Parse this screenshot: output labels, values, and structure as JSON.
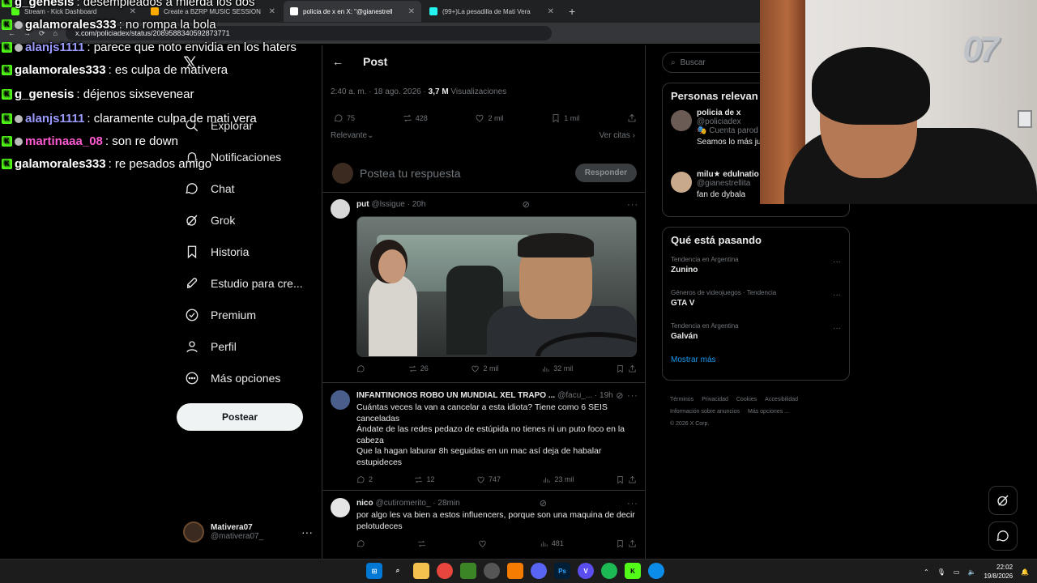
{
  "browser": {
    "tabs": [
      {
        "label": "Stream - Kick Dashboard",
        "fav": "#53fc18",
        "active": false
      },
      {
        "label": "Create a BZRP MUSIC SESSION",
        "fav": "#f9ab00",
        "active": false
      },
      {
        "label": "policia de x en X: \"@gianestrell",
        "fav": "#ffffff",
        "active": true
      },
      {
        "label": "(99+)La pesadilla de Mati Vera",
        "fav": "#25f4ee",
        "active": false
      }
    ],
    "url": "x.com/policiadex/status/2089588340592873771"
  },
  "chat": [
    {
      "user": "g_genesis",
      "color": "#ffffff",
      "msg": ": desempleados a mierda los dos"
    },
    {
      "user": "galamorales333",
      "color": "#ffffff",
      "msg": ": no rompa la bola"
    },
    {
      "user": "alanjs1111",
      "color": "#9b9bff",
      "msg": ": parece que noto envidia en los haters"
    },
    {
      "user": "galamorales333",
      "color": "#ffffff",
      "msg": ": es culpa de matívera"
    },
    {
      "user": "g_genesis",
      "color": "#ffffff",
      "msg": ": déjenos sixsevenear"
    },
    {
      "user": "alanjs1111",
      "color": "#9b9bff",
      "msg": ": claramente culpa de mati vera"
    },
    {
      "user": "martinaaa_08",
      "color": "#ff5ad1",
      "msg": ": son re down"
    },
    {
      "user": "galamorales333",
      "color": "#ffffff",
      "msg": ": re pesados amigo"
    }
  ],
  "nav": {
    "logo": "𝕏",
    "items": [
      {
        "label": "Explorar",
        "icon": "search-icon"
      },
      {
        "label": "Notificaciones",
        "icon": "bell-icon"
      },
      {
        "label": "Chat",
        "icon": "chat-icon"
      },
      {
        "label": "Grok",
        "icon": "grok-icon"
      },
      {
        "label": "Historia",
        "icon": "bookmark-icon"
      },
      {
        "label": "Estudio para cre...",
        "icon": "rocket-icon"
      },
      {
        "label": "Premium",
        "icon": "verified-icon"
      },
      {
        "label": "Perfil",
        "icon": "person-icon"
      },
      {
        "label": "Más opciones",
        "icon": "more-circle-icon"
      }
    ],
    "post_label": "Postear",
    "me": {
      "name": "Mativera07",
      "handle": "@mativera07_"
    }
  },
  "post": {
    "header": "Post",
    "time": "2:40 a. m. · 18 ago. 2026 · ",
    "views_count": "3,7 M",
    "views_label": " Visualizaciones",
    "stats": {
      "replies": "75",
      "reposts": "428",
      "likes": "2 mil",
      "bookmarks": "1 mil"
    },
    "sort": "Relevante",
    "quotes": "Ver citas",
    "reply_placeholder": "Postea tu respuesta",
    "reply_button": "Responder"
  },
  "replies": [
    {
      "name": "put",
      "handle": "@lssigue · 20h",
      "text": "",
      "replies": "",
      "reposts": "26",
      "likes": "2 mil",
      "views": "32 mil"
    },
    {
      "name": "INFANTINONOS ROBO UN MUNDIAL XEL TRAPO ...",
      "handle": "@facu_... · 19h",
      "lines": [
        "Cuántas veces la van a cancelar a esta idiota? Tiene como 6 SEIS canceladas",
        "Ándate de las redes pedazo de estúpida no tienes ni un puto foco en la cabeza",
        "Que la hagan laburar 8h seguidas en un mac así deja de habalar estupideces"
      ],
      "replies": "2",
      "reposts": "12",
      "likes": "747",
      "views": "23 mil"
    },
    {
      "name": "nico",
      "handle": "@cutiromerito_ · 28min",
      "lines": [
        "por algo les va bien a estos influencers, porque son una maquina de decir pelotudeces"
      ],
      "replies": "",
      "reposts": "",
      "likes": "",
      "views": "481"
    }
  ],
  "right": {
    "search_placeholder": "Buscar",
    "people_title": "Personas relevan",
    "people": [
      {
        "name": "policia de x",
        "handle": "@policiadex",
        "extra": "Cuenta parod",
        "bio": "Seamos lo más ju"
      },
      {
        "name": "milu★ edulnatio",
        "handle": "@gianestrellita",
        "extra": "",
        "bio": "fan de dybala"
      }
    ],
    "trends_title": "Qué está pasando",
    "trends": [
      {
        "cat": "Tendencia en Argentina",
        "name": "Zunino"
      },
      {
        "cat": "Géneros de videojuegos · Tendencia",
        "name": "GTA V"
      },
      {
        "cat": "Tendencia en Argentina",
        "name": "Galván"
      }
    ],
    "show_more": "Mostrar más",
    "footer": [
      "Términos",
      "Privacidad",
      "Cookies",
      "Accesibilidad",
      "Información sobre anuncios",
      "Más opciones ...",
      "© 2026 X Corp."
    ]
  },
  "webcam": {
    "balloon_text": "07"
  },
  "taskbar": {
    "time": "22:02",
    "date": "19/8/2026"
  }
}
